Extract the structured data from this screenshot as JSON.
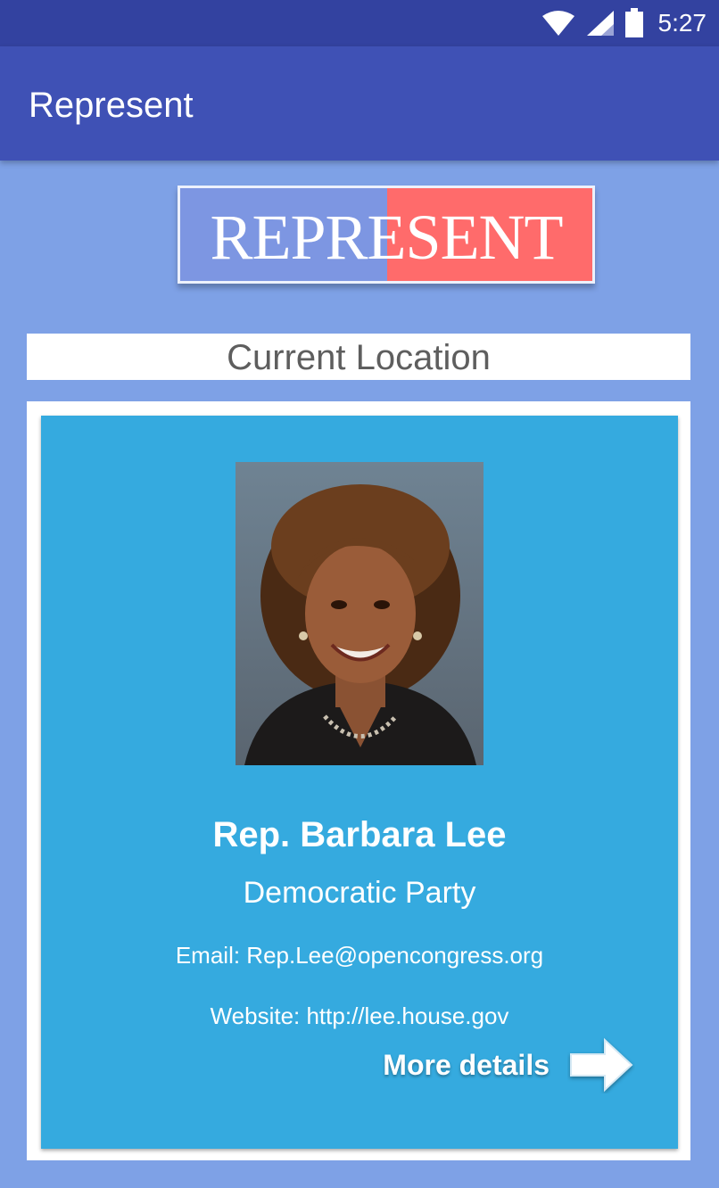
{
  "status_bar": {
    "time": "5:27",
    "icons": [
      "wifi-icon",
      "signal-icon",
      "battery-icon"
    ]
  },
  "app_bar": {
    "title": "Represent"
  },
  "logo": {
    "text": "REPRESENT",
    "colors": {
      "left": "#7d96e2",
      "right": "#ff6b6b"
    }
  },
  "location": {
    "label": "Current Location"
  },
  "representative": {
    "name": "Rep. Barbara Lee",
    "party": "Democratic Party",
    "email": "Email: Rep.Lee@opencongress.org",
    "website": "Website: http://lee.house.gov",
    "more_details_label": "More details",
    "card_color": "#35aadf"
  },
  "colors": {
    "status_bar": "#3342a0",
    "app_bar": "#3f51b5",
    "background": "#7ea1e6"
  }
}
